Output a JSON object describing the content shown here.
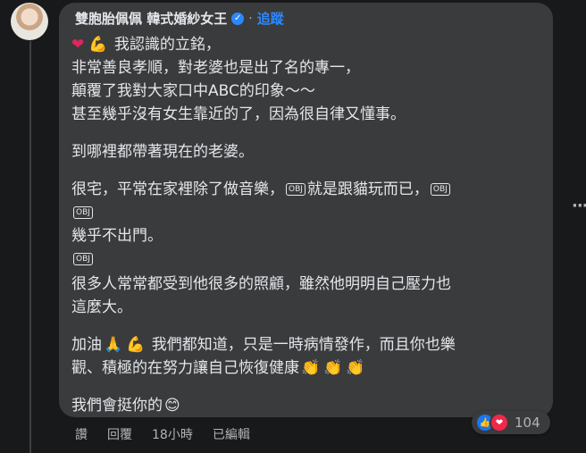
{
  "comment": {
    "author": "雙胞胎佩佩 韓式婚紗女王",
    "separator": "·",
    "follow_label": "追蹤",
    "paragraphs": [
      {
        "lines": [
          "我認識的立銘，",
          "非常善良孝順，對老婆也是出了名的專一，",
          "顛覆了我對大家口中ABC的印象～～",
          "甚至幾乎沒有女生靠近的了，因為很自律又懂事。"
        ]
      },
      {
        "lines": [
          "到哪裡都帶著現在的老婆。"
        ]
      },
      {
        "lines": [
          "很宅，平常在家裡除了做音樂，",
          "就是跟貓玩而已，",
          "幾乎不出門。"
        ]
      },
      {
        "lines": [
          "很多人常常都受到他很多的照顧，雖然他明明自己壓力也",
          "這麼大。"
        ]
      },
      {
        "lines": [
          "加油",
          "我們都知道，只是一時病情發作，而且你也樂",
          "觀、積極的在努力讓自己恢復健康"
        ]
      },
      {
        "lines": [
          "我們會挺你的"
        ]
      }
    ],
    "obj_label": "OBJ",
    "emojis": {
      "heart": "❤",
      "muscle": "💪",
      "pray": "🙏",
      "clap": "👏",
      "smile": "😊"
    },
    "reactions": {
      "like_icon": "👍",
      "love_icon": "❤",
      "count": "104"
    },
    "actions": {
      "like": "讚",
      "reply": "回覆",
      "time": "18小時",
      "edited": "已編輯"
    },
    "more_icon": "···"
  }
}
